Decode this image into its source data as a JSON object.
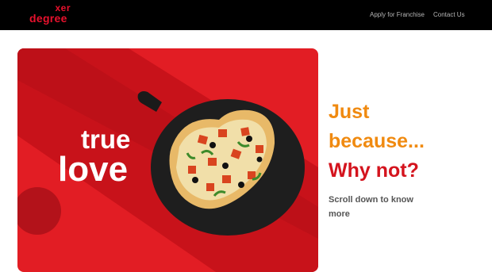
{
  "header": {
    "logo_top": "xer",
    "logo_bottom": "degree",
    "nav": [
      {
        "label": "Apply for Franchise"
      },
      {
        "label": "Contact Us"
      }
    ]
  },
  "hero": {
    "image_text_line1": "true",
    "image_text_line2": "love",
    "image_subject": "heart-shaped pizza on black serving board"
  },
  "promo": {
    "line1": "Just",
    "line2": "because...",
    "line3": "Why not?",
    "subtext": "Scroll down to know more"
  },
  "colors": {
    "brand_red": "#e8112d",
    "orange": "#f08a10",
    "dark_red": "#d4141e",
    "hero_bg": "#e21d24"
  }
}
